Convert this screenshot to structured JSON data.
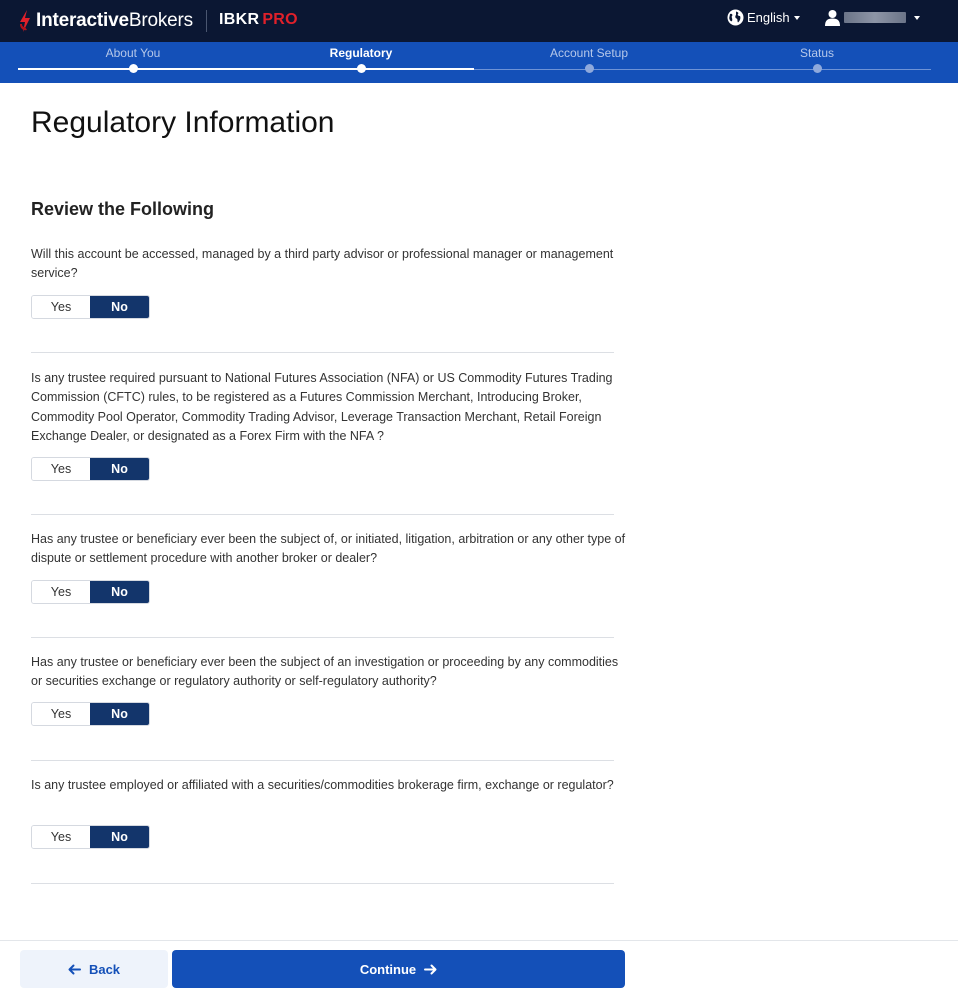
{
  "header": {
    "brand_bold": "Interactive",
    "brand_light": "Brokers",
    "product": "IBKR",
    "product_tier": "PRO",
    "language_label": "English",
    "icons": [
      "ib-logo-icon",
      "globe-icon",
      "user-icon",
      "chevron-down-icon"
    ]
  },
  "steps": [
    {
      "label": "About You",
      "state": "done"
    },
    {
      "label": "Regulatory",
      "state": "active"
    },
    {
      "label": "Account Setup",
      "state": "upcoming"
    },
    {
      "label": "Status",
      "state": "upcoming"
    }
  ],
  "page": {
    "title": "Regulatory Information",
    "section_title": "Review the Following"
  },
  "questions": [
    {
      "text": "Will this account be accessed, managed by a third party advisor or professional manager or management service?",
      "yes_label": "Yes",
      "no_label": "No",
      "selected": "No"
    },
    {
      "text": "Is any trustee required pursuant to National Futures Association (NFA) or US Commodity Futures Trading Commission (CFTC) rules, to be registered as a Futures Commission Merchant, Introducing Broker, Commodity Pool Operator, Commodity Trading Advisor, Leverage Transaction Merchant, Retail Foreign Exchange Dealer, or designated as a Forex Firm with the NFA ?",
      "yes_label": "Yes",
      "no_label": "No",
      "selected": "No"
    },
    {
      "text": "Has any trustee or beneficiary ever been the subject of, or initiated, litigation, arbitration or any other type of dispute or settlement procedure with another broker or dealer?",
      "yes_label": "Yes",
      "no_label": "No",
      "selected": "No"
    },
    {
      "text": "Has any trustee or beneficiary ever been the subject of an investigation or proceeding by any commodities or securities exchange or regulatory authority or self-regulatory authority?",
      "yes_label": "Yes",
      "no_label": "No",
      "selected": "No"
    },
    {
      "text": "Is any trustee employed or affiliated with a securities/commodities brokerage firm, exchange or regulator?",
      "yes_label": "Yes",
      "no_label": "No",
      "selected": "No"
    }
  ],
  "footer": {
    "back_label": "Back",
    "continue_label": "Continue"
  },
  "colors": {
    "topbar": "#0b1733",
    "stepbar": "#1450b8",
    "selected_toggle": "#13356b",
    "brand_red": "#e0202a"
  }
}
